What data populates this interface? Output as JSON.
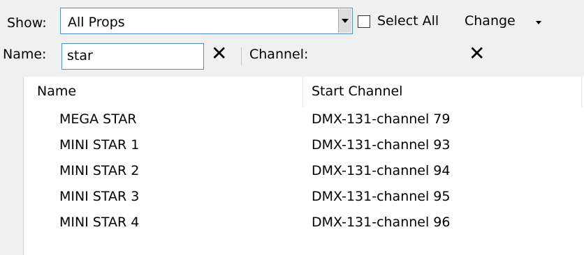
{
  "filter": {
    "show_label": "Show:",
    "show_value": "All Props",
    "select_all_label": "Select All",
    "select_all_checked": false,
    "change_label": "Change",
    "name_label": "Name:",
    "name_value": "star",
    "channel_label": "Channel:",
    "channel_value": ""
  },
  "table": {
    "columns": [
      "Name",
      "Start Channel"
    ],
    "rows": [
      {
        "name": "MEGA STAR",
        "channel": "DMX-131-channel  79"
      },
      {
        "name": "MINI STAR 1",
        "channel": "DMX-131-channel  93"
      },
      {
        "name": "MINI STAR 2",
        "channel": "DMX-131-channel  94"
      },
      {
        "name": "MINI STAR 3",
        "channel": "DMX-131-channel  95"
      },
      {
        "name": "MINI STAR 4",
        "channel": "DMX-131-channel  96"
      }
    ]
  }
}
